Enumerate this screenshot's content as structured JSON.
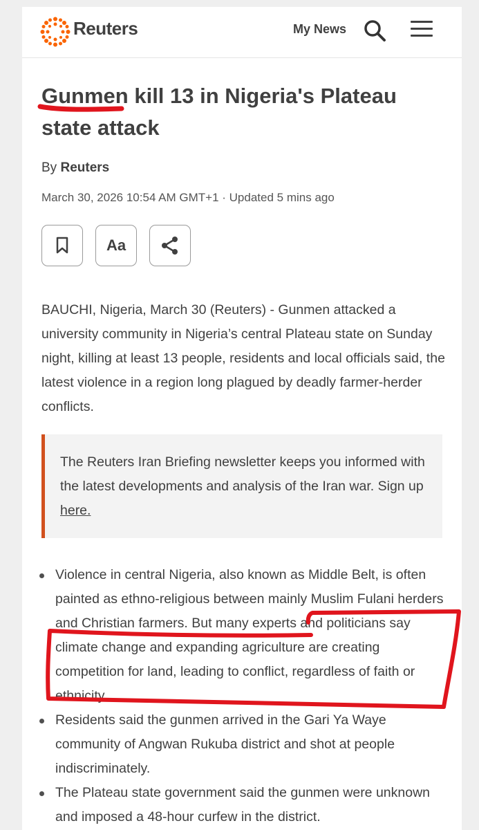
{
  "header": {
    "brand": "Reuters",
    "my_news": "My News",
    "search_icon": "search-icon",
    "menu_icon": "hamburger-menu-icon"
  },
  "article": {
    "headline_line1": "Gunmen kill 13 in Nigeria's Plateau",
    "headline_line2": "state attack",
    "byline_prefix": "By",
    "byline_author": "Reuters",
    "dateline": "March 30, 2026 10:54 AM GMT+1 · Updated 5 mins ago",
    "tools": {
      "bookmark_icon": "bookmark-icon",
      "text_size_label": "Aa",
      "share_icon": "share-icon"
    },
    "lead": "BAUCHI, Nigeria, March 30 (Reuters) - Gunmen attacked a university community in Nigeria’s central Plateau state on Sunday night, killing at least 13 people, residents and local officials said, the latest violence in a region long plagued by deadly farmer-herder conflicts.",
    "promo": {
      "text": "The Reuters Iran Briefing newsletter keeps you informed with the latest developments and analysis of the Iran war. Sign up ",
      "link": "here."
    },
    "bullets": [
      "Violence in central Nigeria, also known as Middle Belt, is often painted as ethno-religious between mainly Muslim Fulani herders and Christian farmers. But many experts and politicians say climate change and expanding agriculture are creating competition for land, leading to conflict, regardless of faith or ethnicity.",
      "Residents said the gunmen arrived in the Gari Ya Waye community of Angwan Rukuba district and shot at people indiscriminately.",
      "The Plateau state government said the gunmen were unknown and imposed a 48-hour curfew in the district."
    ]
  },
  "colors": {
    "accent_orange": "#d1501d",
    "annotation_red": "#e0151d",
    "text_gray": "#404040"
  }
}
